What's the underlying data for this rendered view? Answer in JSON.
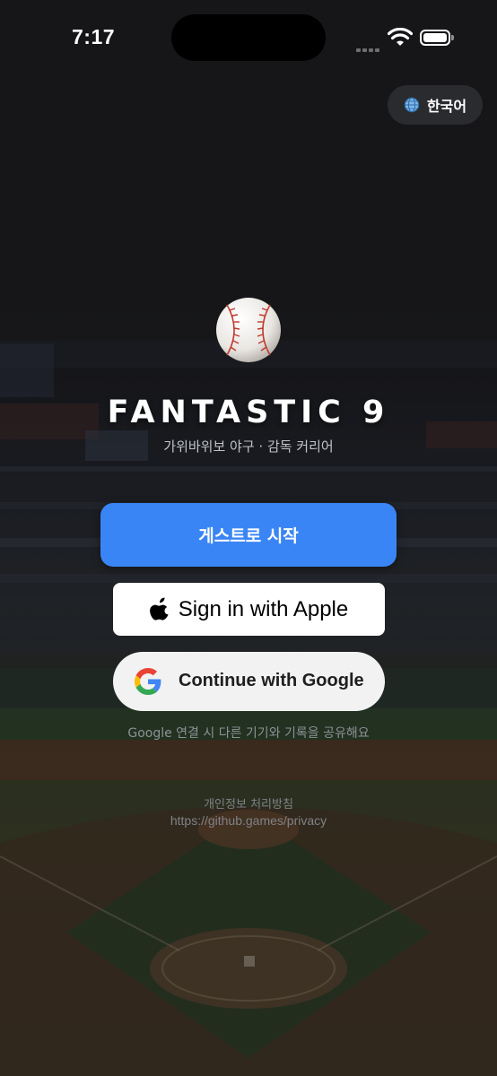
{
  "status_bar": {
    "time": "7:17"
  },
  "language_button": {
    "label": "한국어",
    "icon": "globe-icon"
  },
  "header": {
    "logo_icon": "baseball-icon",
    "title": "FANTASTIC 9",
    "subtitle": "가위바위보 야구 · 감독 커리어"
  },
  "actions": {
    "guest_label": "게스트로 시작",
    "apple_label": "Sign in with Apple",
    "google_label": "Continue with Google",
    "google_note": "Google 연결 시 다른 기기와 기록을 공유해요"
  },
  "footer": {
    "privacy_title": "개인정보 처리방침",
    "privacy_url": "https://github.games/privacy"
  },
  "colors": {
    "accent": "#3a85f5",
    "background": "#17171a",
    "apple_button": "#ffffff",
    "google_button": "#f2f2f2"
  }
}
